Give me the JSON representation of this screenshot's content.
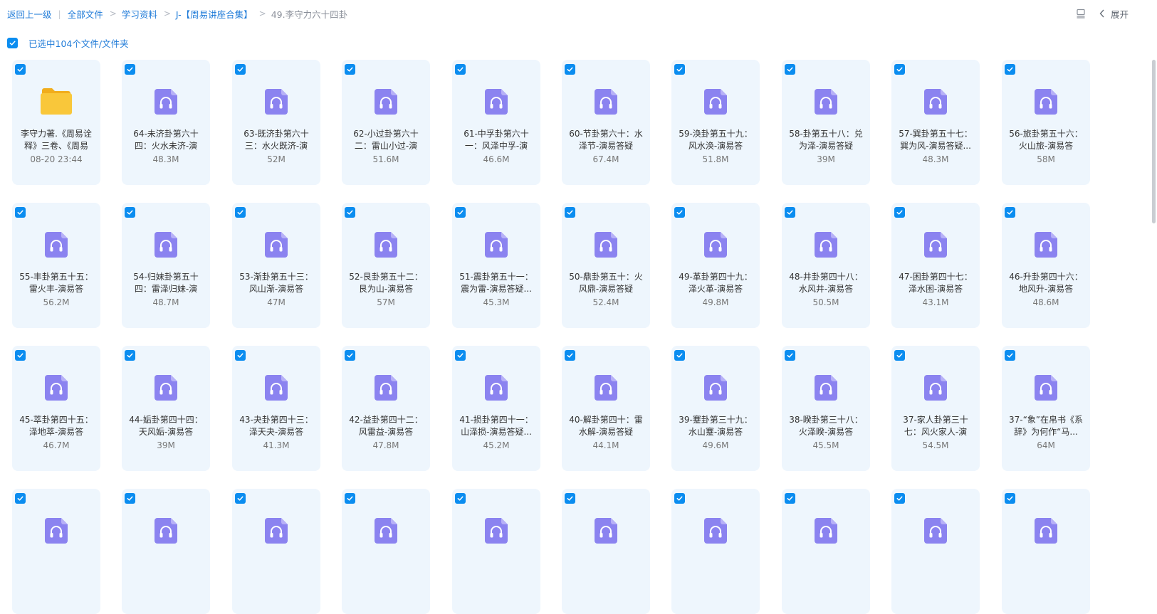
{
  "breadcrumb": {
    "back": "返回上一级",
    "items": [
      "全部文件",
      "学习资料",
      "J-【周易讲座合集】"
    ],
    "current": "49.李守力六十四卦"
  },
  "toolbar": {
    "expand_label": "展开"
  },
  "selection": {
    "text": "已选中104个文件/文件夹"
  },
  "colors": {
    "accent": "#0b8df0",
    "card_bg": "#eef6fd",
    "audio_icon": "#8b83f0",
    "folder": "#f7c12e"
  },
  "files": [
    {
      "type": "folder",
      "name": "李守力著.《周易诠释》三卷、《周易",
      "meta": "08-20 23:44"
    },
    {
      "type": "audio",
      "name": "64-未济卦第六十四：火水未济-演",
      "meta": "48.3M"
    },
    {
      "type": "audio",
      "name": "63-既济卦第六十三：水火既济-演",
      "meta": "52M"
    },
    {
      "type": "audio",
      "name": "62-小过卦第六十二：雷山小过-演",
      "meta": "51.6M"
    },
    {
      "type": "audio",
      "name": "61-中孚卦第六十一：风泽中孚-演",
      "meta": "46.6M"
    },
    {
      "type": "audio",
      "name": "60-节卦第六十：水泽节-演易答疑",
      "meta": "67.4M"
    },
    {
      "type": "audio",
      "name": "59-涣卦第五十九：风水涣-演易答",
      "meta": "51.8M"
    },
    {
      "type": "audio",
      "name": "58-卦第五十八：兑为泽-演易答疑",
      "meta": "39M"
    },
    {
      "type": "audio",
      "name": "57-巽卦第五十七：巽为风-演易答疑...",
      "meta": "48.3M"
    },
    {
      "type": "audio",
      "name": "56-旅卦第五十六：火山旅-演易答",
      "meta": "58M"
    },
    {
      "type": "audio",
      "name": "55-丰卦第五十五：雷火丰-演易答",
      "meta": "56.2M"
    },
    {
      "type": "audio",
      "name": "54-归妹卦第五十四：雷泽归妹-演",
      "meta": "48.7M"
    },
    {
      "type": "audio",
      "name": "53-渐卦第五十三：风山渐-演易答",
      "meta": "47M"
    },
    {
      "type": "audio",
      "name": "52-艮卦第五十二：艮为山-演易答",
      "meta": "57M"
    },
    {
      "type": "audio",
      "name": "51-震卦第五十一：震为雷-演易答疑...",
      "meta": "45.3M"
    },
    {
      "type": "audio",
      "name": "50-鼎卦第五十：火风鼎-演易答疑",
      "meta": "52.4M"
    },
    {
      "type": "audio",
      "name": "49-革卦第四十九：泽火革-演易答",
      "meta": "49.8M"
    },
    {
      "type": "audio",
      "name": "48-井卦第四十八：水风井-演易答",
      "meta": "50.5M"
    },
    {
      "type": "audio",
      "name": "47-困卦第四十七：泽水困-演易答",
      "meta": "43.1M"
    },
    {
      "type": "audio",
      "name": "46-升卦第四十六：地风升-演易答",
      "meta": "48.6M"
    },
    {
      "type": "audio",
      "name": "45-萃卦第四十五：泽地萃-演易答",
      "meta": "46.7M"
    },
    {
      "type": "audio",
      "name": "44-姤卦第四十四：天风姤-演易答",
      "meta": "39M"
    },
    {
      "type": "audio",
      "name": "43-夬卦第四十三：泽天夬-演易答",
      "meta": "41.3M"
    },
    {
      "type": "audio",
      "name": "42-益卦第四十二：风雷益-演易答",
      "meta": "47.8M"
    },
    {
      "type": "audio",
      "name": "41-损卦第四十一：山泽损-演易答疑...",
      "meta": "45.2M"
    },
    {
      "type": "audio",
      "name": "40-解卦第四十：雷水解-演易答疑",
      "meta": "44.1M"
    },
    {
      "type": "audio",
      "name": "39-蹇卦第三十九：水山蹇-演易答",
      "meta": "49.6M"
    },
    {
      "type": "audio",
      "name": "38-睽卦第三十八：火泽睽-演易答",
      "meta": "45.5M"
    },
    {
      "type": "audio",
      "name": "37-家人卦第三十七：风火家人-演",
      "meta": "54.5M"
    },
    {
      "type": "audio",
      "name": "37-“象”在帛书《系辞》为何作“马...",
      "meta": "64M"
    },
    {
      "type": "audio",
      "name": "",
      "meta": ""
    },
    {
      "type": "audio",
      "name": "",
      "meta": ""
    },
    {
      "type": "audio",
      "name": "",
      "meta": ""
    },
    {
      "type": "audio",
      "name": "",
      "meta": ""
    },
    {
      "type": "audio",
      "name": "",
      "meta": ""
    },
    {
      "type": "audio",
      "name": "",
      "meta": ""
    },
    {
      "type": "audio",
      "name": "",
      "meta": ""
    },
    {
      "type": "audio",
      "name": "",
      "meta": ""
    },
    {
      "type": "audio",
      "name": "",
      "meta": ""
    },
    {
      "type": "audio",
      "name": "",
      "meta": ""
    }
  ]
}
